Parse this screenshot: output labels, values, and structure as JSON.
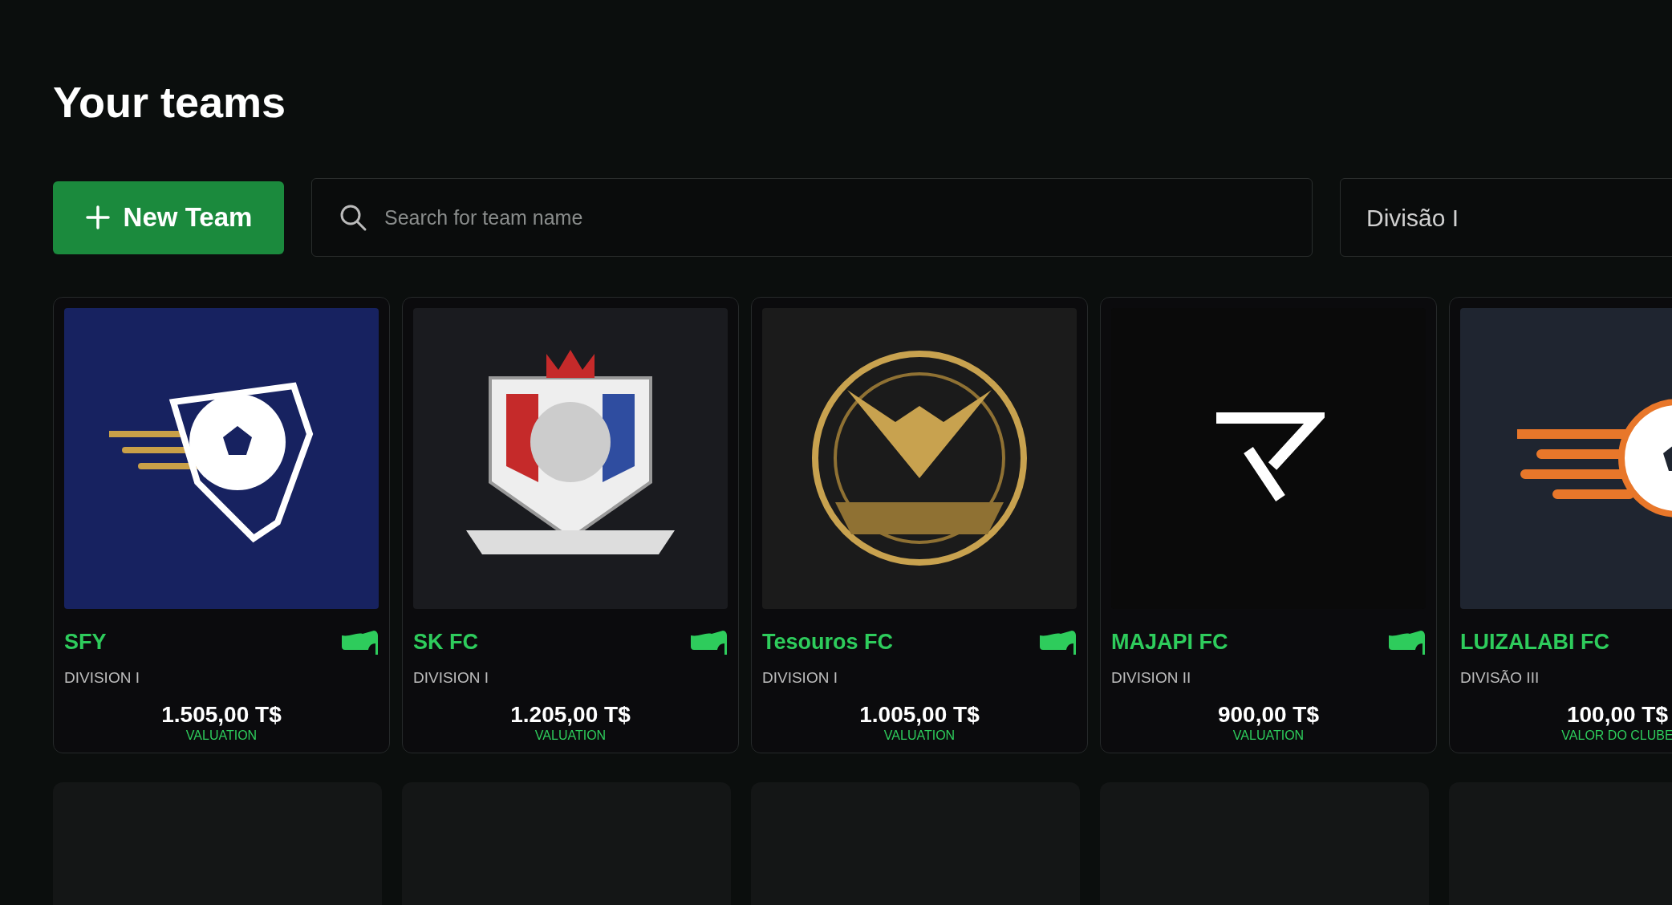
{
  "title": "Your teams",
  "new_team_button": {
    "label": "New Team"
  },
  "search": {
    "placeholder": "Search for team name"
  },
  "division_filter": {
    "value": "Divisão I"
  },
  "teams": [
    {
      "name": "SFY",
      "division": "DIVISION I",
      "value": "1.505,00 T$",
      "value_label": "VALUATION",
      "kind": "shield-ball",
      "badge": true
    },
    {
      "name": "SK FC",
      "division": "DIVISION I",
      "value": "1.205,00 T$",
      "value_label": "VALUATION",
      "kind": "lion-crest",
      "badge": true
    },
    {
      "name": "Tesouros FC",
      "division": "DIVISION I",
      "value": "1.005,00 T$",
      "value_label": "VALUATION",
      "kind": "eagle-emblem",
      "badge": true
    },
    {
      "name": "MAJAPI FC",
      "division": "DIVISION II",
      "value": "900,00 T$",
      "value_label": "VALUATION",
      "kind": "letter-mark",
      "badge": true
    },
    {
      "name": "LUIZALABI FC",
      "division": "DIVISÃO III",
      "value": "100,00 T$",
      "value_label": "VALOR DO CLUBE",
      "kind": "speed-ball",
      "badge": false
    }
  ]
}
